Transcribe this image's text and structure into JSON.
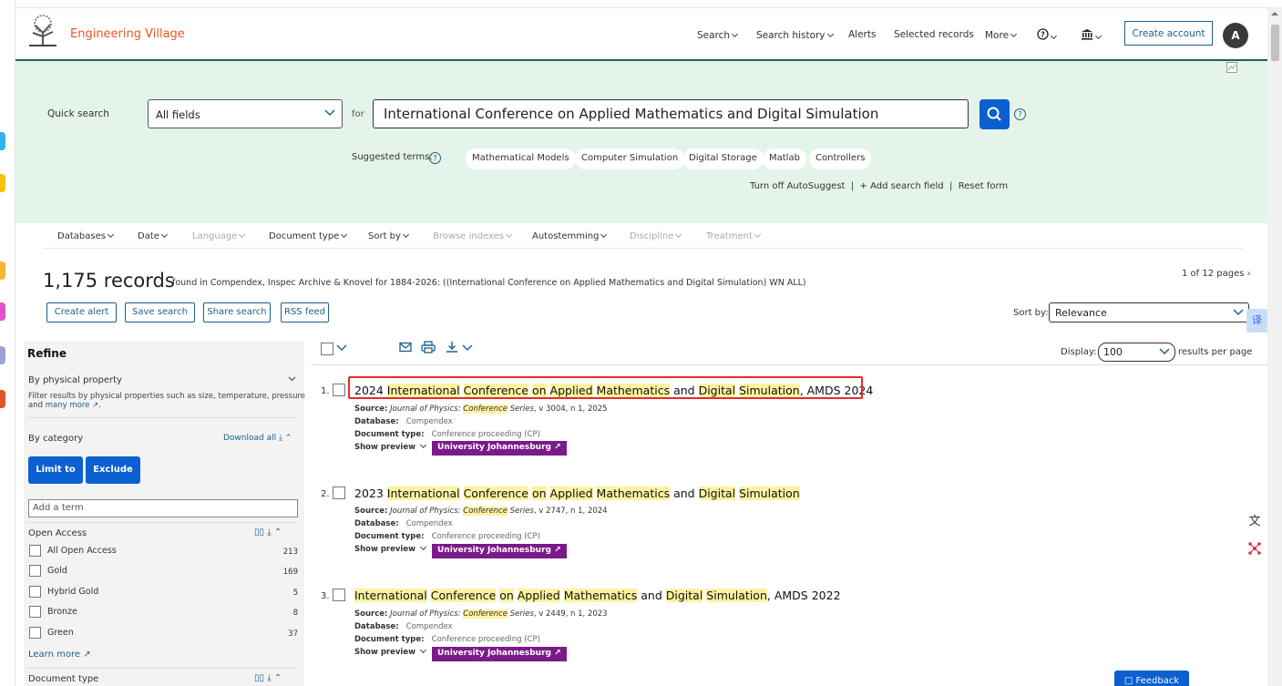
{
  "header": {
    "brand": "Engineering Village",
    "nav": [
      "Search",
      "Search history",
      "Alerts",
      "Selected records",
      "More"
    ],
    "create_account": "Create account",
    "avatar_initial": "A"
  },
  "quick_search": {
    "label": "Quick search",
    "field": "All fields",
    "for_label": "for",
    "query": "International Conference on Applied Mathematics and Digital Simulation",
    "help": "?",
    "suggested_label": "Suggested terms:",
    "suggested_terms": [
      "Mathematical Models",
      "Computer Simulation",
      "Digital Storage",
      "Matlab",
      "Controllers"
    ],
    "turn_off_autosuggest": "Turn off AutoSuggest",
    "add_search_field": "+ Add search field",
    "reset_form": "Reset form"
  },
  "filters": [
    "Databases",
    "Date",
    "Language",
    "Document type",
    "Sort by",
    "Browse indexes",
    "Autostemming",
    "Discipline",
    "Treatment"
  ],
  "results_header": {
    "count": "1,175 records",
    "description": "found in Compendex, Inspec Archive & Knovel for 1884-2026: ((International Conference on Applied Mathematics and Digital Simulation) WN ALL)",
    "pages": "1 of 12 pages",
    "buttons": [
      "Create alert",
      "Save search",
      "Share search",
      "RSS feed"
    ],
    "sort_label": "Sort by:",
    "sort_value": "Relevance",
    "display_label": "Display:",
    "display_value": "100",
    "per_page": "results per page",
    "translate_glyph": "译"
  },
  "refine": {
    "title": "Refine",
    "physical_property": "By physical property",
    "physical_desc_1": "Filter results by physical properties such as size, temperature, pressure",
    "physical_desc_2a": "and",
    "physical_desc_2b": "many more",
    "by_category": "By category",
    "download_all": "Download all",
    "limit_to": "Limit to",
    "exclude": "Exclude",
    "add_term_placeholder": "Add a term",
    "open_access": "Open Access",
    "oa_items": [
      {
        "label": "All Open Access",
        "count": "213"
      },
      {
        "label": "Gold",
        "count": "169"
      },
      {
        "label": "Hybrid Gold",
        "count": "5"
      },
      {
        "label": "Bronze",
        "count": "8"
      },
      {
        "label": "Green",
        "count": "37"
      }
    ],
    "learn_more": "Learn more",
    "document_type": "Document type"
  },
  "results": [
    {
      "num": "1.",
      "title_parts": [
        [
          "2024 ",
          false
        ],
        [
          "International",
          true
        ],
        [
          " ",
          false
        ],
        [
          "Conference",
          true
        ],
        [
          " ",
          false
        ],
        [
          "on",
          true
        ],
        [
          " ",
          false
        ],
        [
          "Applied",
          true
        ],
        [
          " ",
          false
        ],
        [
          "Mathematics",
          true
        ],
        [
          " and ",
          false
        ],
        [
          "Digital",
          true
        ],
        [
          " ",
          false
        ],
        [
          "Simulation",
          true
        ],
        [
          ", AMDS 2024",
          false
        ]
      ],
      "source_label": "Source:",
      "source_pre": "Journal of Physics: ",
      "source_hl": "Conference",
      "source_post": " Series",
      "source_rest": ", v 3004, n 1, 2025",
      "database_label": "Database:",
      "database": "Compendex",
      "doctype_label": "Document type:",
      "doctype": "Conference proceeding (CP)",
      "show_preview": "Show preview",
      "university": "University Johannesburg"
    },
    {
      "num": "2.",
      "title_parts": [
        [
          "2023 ",
          false
        ],
        [
          "International",
          true
        ],
        [
          " ",
          false
        ],
        [
          "Conference",
          true
        ],
        [
          " ",
          false
        ],
        [
          "on",
          true
        ],
        [
          " ",
          false
        ],
        [
          "Applied",
          true
        ],
        [
          " ",
          false
        ],
        [
          "Mathematics",
          true
        ],
        [
          " and ",
          false
        ],
        [
          "Digital",
          true
        ],
        [
          " ",
          false
        ],
        [
          "Simulation",
          true
        ]
      ],
      "source_label": "Source:",
      "source_pre": "Journal of Physics: ",
      "source_hl": "Conference",
      "source_post": " Series",
      "source_rest": ", v 2747, n 1, 2024",
      "database_label": "Database:",
      "database": "Compendex",
      "doctype_label": "Document type:",
      "doctype": "Conference proceeding (CP)",
      "show_preview": "Show preview",
      "university": "University Johannesburg"
    },
    {
      "num": "3.",
      "title_parts": [
        [
          "International",
          true
        ],
        [
          " ",
          false
        ],
        [
          "Conference",
          true
        ],
        [
          " ",
          false
        ],
        [
          "on",
          true
        ],
        [
          " ",
          false
        ],
        [
          "Applied",
          true
        ],
        [
          " ",
          false
        ],
        [
          "Mathematics",
          true
        ],
        [
          " and ",
          false
        ],
        [
          "Digital",
          true
        ],
        [
          " ",
          false
        ],
        [
          "Simulation",
          true
        ],
        [
          ", AMDS 2022",
          false
        ]
      ],
      "source_label": "Source:",
      "source_pre": "Journal of Physics: ",
      "source_hl": "Conference",
      "source_post": " Series",
      "source_rest": ", v 2449, n 1, 2023",
      "database_label": "Database:",
      "database": "Compendex",
      "doctype_label": "Document type:",
      "doctype": "Conference proceeding (CP)",
      "show_preview": "Show preview",
      "university": "University Johannesburg"
    }
  ],
  "feedback": "Feedback",
  "colors": {
    "brand": "#e9571d",
    "accent_green": "#1d6a4a",
    "search_band": "#e4f4ea",
    "primary_button": "#0a5fd1",
    "university_badge": "#7b1a8a",
    "highlight": "#fbf3a0",
    "annotation_box": "#e52c2c"
  }
}
